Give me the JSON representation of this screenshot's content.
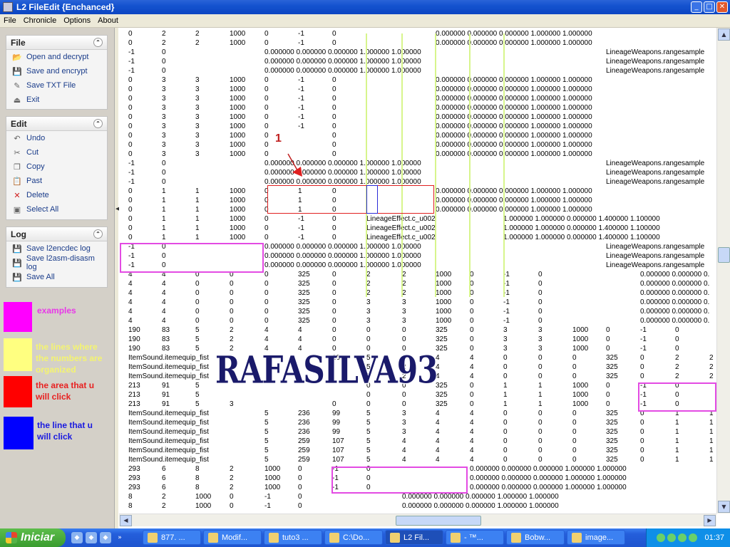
{
  "window": {
    "title": "L2 FileEdit {Enchanced}",
    "ctrl_min": "_",
    "ctrl_max": "□",
    "ctrl_close": "✕"
  },
  "menu": [
    "File",
    "Chronicle",
    "Options",
    "About"
  ],
  "panels": {
    "file": {
      "title": "File",
      "items": [
        {
          "label": "Open and decrypt",
          "icon": "folder-icon",
          "glyph": "📂"
        },
        {
          "label": "Save and encrypt",
          "icon": "disk-icon",
          "glyph": "💾"
        },
        {
          "label": "Save TXT File",
          "icon": "pencil-icon",
          "glyph": "✎"
        },
        {
          "label": "Exit",
          "icon": "exit-icon",
          "glyph": "⏏"
        }
      ]
    },
    "edit": {
      "title": "Edit",
      "items": [
        {
          "label": "Undo",
          "icon": "undo-icon",
          "glyph": "↶"
        },
        {
          "label": "Cut",
          "icon": "scissors-icon",
          "glyph": "✂"
        },
        {
          "label": "Copy",
          "icon": "copy-icon",
          "glyph": "❐"
        },
        {
          "label": "Past",
          "icon": "paste-icon",
          "glyph": "📋"
        },
        {
          "label": "Delete",
          "icon": "delete-icon",
          "glyph": "✕"
        },
        {
          "label": "Select All",
          "icon": "select-all-icon",
          "glyph": "▣"
        }
      ]
    },
    "log": {
      "title": "Log",
      "items": [
        {
          "label": "Save l2encdec log",
          "icon": "disk-icon",
          "glyph": "💾"
        },
        {
          "label": "Save l2asm-disasm log",
          "icon": "disk-icon",
          "glyph": "💾"
        },
        {
          "label": "Save All",
          "icon": "disk-icon",
          "glyph": "💾"
        }
      ]
    },
    "collapse_glyph": "⌃"
  },
  "legend": [
    {
      "text": "examples",
      "color": "#ff00ff",
      "text_color": "#e838e8"
    },
    {
      "text": "the lines where the numbers are organized",
      "color": "#ffff80",
      "text_color": "#f4f470"
    },
    {
      "text": "the area that u will click",
      "color": "#ff0000",
      "text_color": "#e82020"
    },
    {
      "text": "the line that u will click",
      "color": "#0000ff",
      "text_color": "#1a1ae0"
    }
  ],
  "overlays": {
    "watermark": "RAFASILVA93",
    "annotation_number": "1"
  },
  "rows": [
    [
      "0",
      "2",
      "2",
      "1000",
      "0",
      "-1",
      "0",
      "",
      "",
      "",
      "0.000000 0.000000 0.000000 1.000000 1.000000",
      "",
      ""
    ],
    [
      "0",
      "2",
      "2",
      "1000",
      "0",
      "-1",
      "0",
      "",
      "",
      "",
      "0.000000 0.000000 0.000000 1.000000 1.000000",
      "",
      ""
    ],
    [
      "-1",
      "0",
      "",
      "",
      "0.000000 0.000000 0.000000 1.000000 1.000000",
      "",
      "",
      "",
      "",
      "",
      "",
      "",
      "LineageWeapons.rangesample"
    ],
    [
      "-1",
      "0",
      "",
      "",
      "0.000000 0.000000 0.000000 1.000000 1.000000",
      "",
      "",
      "",
      "",
      "",
      "",
      "",
      "LineageWeapons.rangesample"
    ],
    [
      "-1",
      "0",
      "",
      "",
      "0.000000 0.000000 0.000000 1.000000 1.000000",
      "",
      "",
      "",
      "",
      "",
      "",
      "",
      "LineageWeapons.rangesample"
    ],
    [
      "0",
      "3",
      "3",
      "1000",
      "0",
      "-1",
      "0",
      "",
      "",
      "",
      "0.000000 0.000000 0.000000 1.000000 1.000000",
      "",
      ""
    ],
    [
      "0",
      "3",
      "3",
      "1000",
      "0",
      "-1",
      "0",
      "",
      "",
      "",
      "0.000000 0.000000 0.000000 1.000000 1.000000",
      "",
      ""
    ],
    [
      "0",
      "3",
      "3",
      "1000",
      "0",
      "-1",
      "0",
      "",
      "",
      "",
      "0.000000 0.000000 0.000000 1.000000 1.000000",
      "",
      ""
    ],
    [
      "0",
      "3",
      "3",
      "1000",
      "0",
      "-1",
      "0",
      "",
      "",
      "",
      "0.000000 0.000000 0.000000 1.000000 1.000000",
      "",
      ""
    ],
    [
      "0",
      "3",
      "3",
      "1000",
      "0",
      "-1",
      "0",
      "",
      "",
      "",
      "0.000000 0.000000 0.000000 1.000000 1.000000",
      "",
      ""
    ],
    [
      "0",
      "3",
      "3",
      "1000",
      "0",
      "-1",
      "0",
      "",
      "",
      "",
      "0.000000 0.000000 0.000000 1.000000 1.000000",
      "",
      ""
    ],
    [
      "0",
      "3",
      "3",
      "1000",
      "0",
      "",
      "0",
      "",
      "",
      "",
      "0.000000 0.000000 0.000000 1.000000 1.000000",
      "",
      ""
    ],
    [
      "0",
      "3",
      "3",
      "1000",
      "0",
      "",
      "0",
      "",
      "",
      "",
      "0.000000 0.000000 0.000000 1.000000 1.000000",
      "",
      ""
    ],
    [
      "0",
      "3",
      "3",
      "1000",
      "0",
      "",
      "0",
      "",
      "",
      "",
      "0.000000 0.000000 0.000000 1.000000 1.000000",
      "",
      ""
    ],
    [
      "-1",
      "0",
      "",
      "",
      "0.000000 0.000000 0.000000 1.000000 1.000000",
      "",
      "",
      "",
      "",
      "",
      "",
      "",
      "LineageWeapons.rangesample"
    ],
    [
      "-1",
      "0",
      "",
      "",
      "0.000000 0.000000 0.000000 1.000000 1.000000",
      "",
      "",
      "",
      "",
      "",
      "",
      "",
      "LineageWeapons.rangesample"
    ],
    [
      "-1",
      "0",
      "",
      "",
      "0.000000 0.000000 0.000000 1.000000 1.000000",
      "",
      "",
      "",
      "",
      "",
      "",
      "",
      "LineageWeapons.rangesample"
    ],
    [
      "0",
      "1",
      "1",
      "1000",
      "0",
      "1",
      "0",
      "",
      "",
      "",
      "0.000000 0.000000 0.000000 1.000000 1.000000",
      "",
      ""
    ],
    [
      "0",
      "1",
      "1",
      "1000",
      "0",
      "1",
      "0",
      "",
      "",
      "",
      "0.000000 0.000000 0.000000 1.000000 1.000000",
      "",
      ""
    ],
    [
      "0",
      "1",
      "1",
      "1000",
      "0",
      "1",
      "0",
      "",
      "",
      "",
      "0.000000 0.000000 0.000000 1.000000 1.000000",
      "",
      ""
    ],
    [
      "0",
      "1",
      "1",
      "1000",
      "0",
      "-1",
      "0",
      "LineageEffect.c_u002",
      "",
      "",
      "",
      "1.000000 1.000000 0.000000 1.400000 1.100000",
      ""
    ],
    [
      "0",
      "1",
      "1",
      "1000",
      "0",
      "-1",
      "0",
      "LineageEffect.c_u002",
      "",
      "",
      "",
      "1.000000 1.000000 0.000000 1.400000 1.100000",
      ""
    ],
    [
      "0",
      "1",
      "1",
      "1000",
      "0",
      "-1",
      "0",
      "LineageEffect.c_u002",
      "",
      "",
      "",
      "1.000000 1.000000 0.000000 1.400000 1.100000",
      ""
    ],
    [
      "-1",
      "0",
      "",
      "",
      "0.000000 0.000000 0.000000 1.000000 1.000000",
      "",
      "",
      "",
      "",
      "",
      "",
      "",
      "LineageWeapons.rangesample"
    ],
    [
      "-1",
      "0",
      "",
      "",
      "0.000000 0.000000 0.000000 1.000000 1.000000",
      "",
      "",
      "",
      "",
      "",
      "",
      "",
      "LineageWeapons.rangesample"
    ],
    [
      "-1",
      "0",
      "",
      "",
      "0.000000 0.000000 0.000000 1.000000 1.000000",
      "",
      "",
      "",
      "",
      "",
      "",
      "",
      "LineageWeapons.rangesample"
    ]
  ],
  "rows2": [
    [
      "4",
      "4",
      "0",
      "0",
      "0",
      "325",
      "0",
      "2",
      "2",
      "1000",
      "0",
      "-1",
      "0",
      "",
      "0.000000 0.000000 0."
    ],
    [
      "4",
      "4",
      "0",
      "0",
      "0",
      "325",
      "0",
      "2",
      "2",
      "1000",
      "0",
      "-1",
      "0",
      "",
      "0.000000 0.000000 0."
    ],
    [
      "4",
      "4",
      "0",
      "0",
      "0",
      "325",
      "0",
      "2",
      "2",
      "1000",
      "0",
      "-1",
      "0",
      "",
      "0.000000 0.000000 0."
    ],
    [
      "4",
      "4",
      "0",
      "0",
      "0",
      "325",
      "0",
      "3",
      "3",
      "1000",
      "0",
      "-1",
      "0",
      "",
      "0.000000 0.000000 0."
    ],
    [
      "4",
      "4",
      "0",
      "0",
      "0",
      "325",
      "0",
      "3",
      "3",
      "1000",
      "0",
      "-1",
      "0",
      "",
      "0.000000 0.000000 0."
    ],
    [
      "4",
      "4",
      "0",
      "0",
      "0",
      "325",
      "0",
      "3",
      "3",
      "1000",
      "0",
      "-1",
      "0",
      "",
      "0.000000 0.000000 0."
    ]
  ],
  "rows3": [
    [
      "190",
      "83",
      "5",
      "2",
      "4",
      "4",
      "0",
      "0",
      "0",
      "325",
      "0",
      "3",
      "3",
      "1000",
      "0",
      "-1",
      "0",
      ""
    ],
    [
      "190",
      "83",
      "5",
      "2",
      "4",
      "4",
      "0",
      "0",
      "0",
      "325",
      "0",
      "3",
      "3",
      "1000",
      "0",
      "-1",
      "0",
      ""
    ],
    [
      "190",
      "83",
      "5",
      "2",
      "4",
      "4",
      "0",
      "0",
      "0",
      "325",
      "0",
      "3",
      "3",
      "1000",
      "0",
      "-1",
      "0",
      ""
    ],
    [
      "ItemSound.itemequip_fist",
      "",
      "",
      "",
      "",
      "",
      "36",
      "5",
      "2",
      "4",
      "4",
      "0",
      "0",
      "0",
      "325",
      "0",
      "2",
      "2"
    ],
    [
      "ItemSound.itemequip_fist",
      "",
      "",
      "",
      "",
      "",
      "",
      "5",
      "2",
      "4",
      "4",
      "0",
      "0",
      "0",
      "325",
      "0",
      "2",
      "2"
    ],
    [
      "ItemSound.itemequip_fist",
      "",
      "",
      "",
      "",
      "",
      "",
      "5",
      "2",
      "4",
      "4",
      "0",
      "0",
      "0",
      "325",
      "0",
      "2",
      "2"
    ],
    [
      "213",
      "91",
      "5",
      "",
      "",
      "",
      "",
      "0",
      "0",
      "325",
      "0",
      "1",
      "1",
      "1000",
      "0",
      "-1",
      "0",
      ""
    ],
    [
      "213",
      "91",
      "5",
      "",
      "",
      "",
      "",
      "0",
      "0",
      "325",
      "0",
      "1",
      "1",
      "1000",
      "0",
      "-1",
      "0",
      ""
    ],
    [
      "213",
      "91",
      "5",
      "3",
      "",
      "",
      "0",
      "0",
      "0",
      "325",
      "0",
      "1",
      "1",
      "1000",
      "0",
      "-1",
      "0",
      ""
    ],
    [
      "ItemSound.itemequip_fist",
      "",
      "",
      "",
      "5",
      "236",
      "99",
      "5",
      "3",
      "4",
      "4",
      "0",
      "0",
      "0",
      "325",
      "0",
      "1",
      "1"
    ],
    [
      "ItemSound.itemequip_fist",
      "",
      "",
      "",
      "5",
      "236",
      "99",
      "5",
      "3",
      "4",
      "4",
      "0",
      "0",
      "0",
      "325",
      "0",
      "1",
      "1"
    ],
    [
      "ItemSound.itemequip_fist",
      "",
      "",
      "",
      "5",
      "236",
      "99",
      "5",
      "3",
      "4",
      "4",
      "0",
      "0",
      "0",
      "325",
      "0",
      "1",
      "1"
    ],
    [
      "ItemSound.itemequip_fist",
      "",
      "",
      "",
      "5",
      "259",
      "107",
      "5",
      "4",
      "4",
      "4",
      "0",
      "0",
      "0",
      "325",
      "0",
      "1",
      "1"
    ],
    [
      "ItemSound.itemequip_fist",
      "",
      "",
      "",
      "5",
      "259",
      "107",
      "5",
      "4",
      "4",
      "4",
      "0",
      "0",
      "0",
      "325",
      "0",
      "1",
      "1"
    ],
    [
      "ItemSound.itemequip_fist",
      "",
      "",
      "",
      "5",
      "259",
      "107",
      "5",
      "4",
      "4",
      "4",
      "0",
      "0",
      "0",
      "325",
      "0",
      "1",
      "1"
    ]
  ],
  "rows4": [
    [
      "293",
      "6",
      "8",
      "2",
      "1000",
      "0",
      "-1",
      "0",
      "0.000000 0.000000 0.000000 1.000000 1.000000"
    ],
    [
      "293",
      "6",
      "8",
      "2",
      "1000",
      "0",
      "-1",
      "0",
      "0.000000 0.000000 0.000000 1.000000 1.000000"
    ],
    [
      "293",
      "6",
      "8",
      "2",
      "1000",
      "0",
      "-1",
      "0",
      "0.000000 0.000000 0.000000 1.000000 1.000000"
    ],
    [
      "8",
      "2",
      "1000",
      "0",
      "-1",
      "0",
      "",
      "",
      "0.000000 0.000000 0.000000 1.000000 1.000000"
    ],
    [
      "8",
      "2",
      "1000",
      "0",
      "-1",
      "0",
      "",
      "",
      "0.000000 0.000000 0.000000 1.000000 1.000000"
    ]
  ],
  "scroll": {
    "up": "▲",
    "down": "▼",
    "left": "◀",
    "right": "▶"
  },
  "taskbar": {
    "start": "Iniciar",
    "quick_launch": [
      {
        "icon": "app-icon",
        "glyph": "◆"
      },
      {
        "icon": "app-icon",
        "glyph": "◆"
      },
      {
        "icon": "app-icon",
        "glyph": "◆"
      },
      {
        "icon": "more-icon",
        "glyph": "»"
      }
    ],
    "tasks": [
      {
        "label": "877. ...",
        "active": false
      },
      {
        "label": "Modif...",
        "active": false
      },
      {
        "label": "tuto3 ...",
        "active": false
      },
      {
        "label": "C:\\Do...",
        "active": false
      },
      {
        "label": "L2 Fil...",
        "active": true
      },
      {
        "label": "- ™...",
        "active": false
      },
      {
        "label": "Bobw...",
        "active": false
      },
      {
        "label": "image...",
        "active": false
      }
    ],
    "clock": "01:37"
  }
}
